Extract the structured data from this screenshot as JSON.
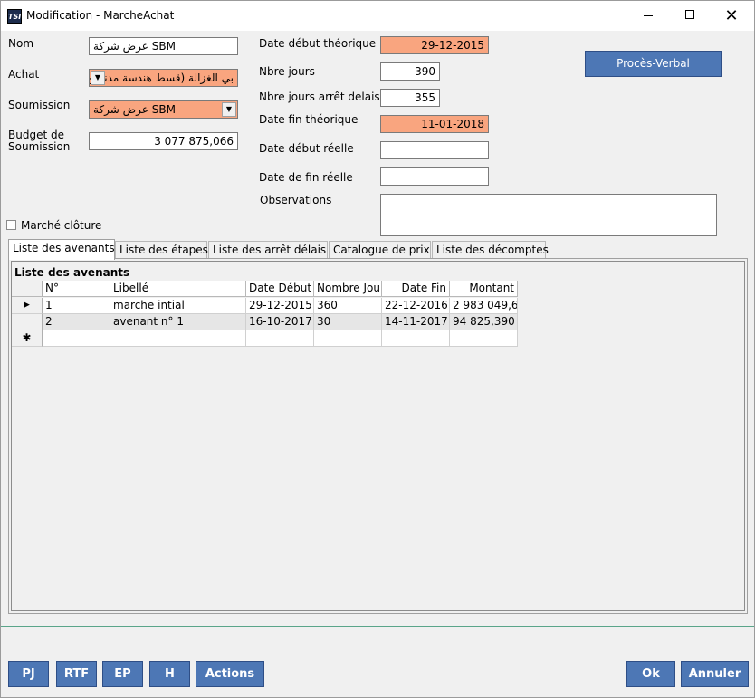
{
  "window": {
    "title": "Modification - MarcheAchat",
    "icon": "TSI"
  },
  "form": {
    "nom_label": "Nom",
    "nom_value": "عرض شركة SBM",
    "achat_label": "Achat",
    "achat_value": "بي الغزالة (قسط هندسة مدنية ع",
    "soumission_label": "Soumission",
    "soumission_value": "عرض شركة SBM",
    "budget_label_1": "Budget de",
    "budget_label_2": "Soumission",
    "budget_value": "3 077 875,066",
    "date_debut_theo_label": "Date début théorique",
    "date_debut_theo_value": "29-12-2015",
    "nbre_jours_label": "Nbre jours",
    "nbre_jours_value": "390",
    "nbre_jours_arret_label": "Nbre jours arrêt delais",
    "nbre_jours_arret_value": "355",
    "date_fin_theo_label": "Date fin théorique",
    "date_fin_theo_value": "11-01-2018",
    "date_debut_reelle_label": "Date début réelle",
    "date_debut_reelle_value": "",
    "date_fin_reelle_label": "Date de fin réelle",
    "date_fin_reelle_value": "",
    "observations_label": "Observations",
    "observations_value": "",
    "marche_cloture_label": "Marché clôture",
    "proces_verbal_button": "Procès-Verbal"
  },
  "tabs": [
    {
      "label": "Liste des avenants",
      "active": true
    },
    {
      "label": "Liste des étapes",
      "active": false
    },
    {
      "label": "Liste des arrêt délais",
      "active": false
    },
    {
      "label": "Catalogue de prix",
      "active": false
    },
    {
      "label": "Liste des décomptes",
      "active": false
    }
  ],
  "grid": {
    "caption": "Liste des avenants",
    "columns": [
      "N°",
      "Libellé",
      "Date Début",
      "Nombre Jou",
      "Date Fin",
      "Montant"
    ],
    "rows": [
      [
        "1",
        "marche intial",
        "29-12-2015",
        "360",
        "22-12-2016",
        "2 983 049,6"
      ],
      [
        "2",
        "avenant n° 1",
        "16-10-2017",
        "30",
        "14-11-2017",
        "94 825,390"
      ]
    ],
    "current_row_marker": "▶",
    "new_row_marker": "✱"
  },
  "footer": {
    "pj": "PJ",
    "rtf": "RTF",
    "ep": "EP",
    "h": "H",
    "actions": "Actions",
    "ok": "Ok",
    "annuler": "Annuler"
  },
  "colors": {
    "accent_button": "#4d77b5",
    "required_field": "#f9a57f"
  }
}
